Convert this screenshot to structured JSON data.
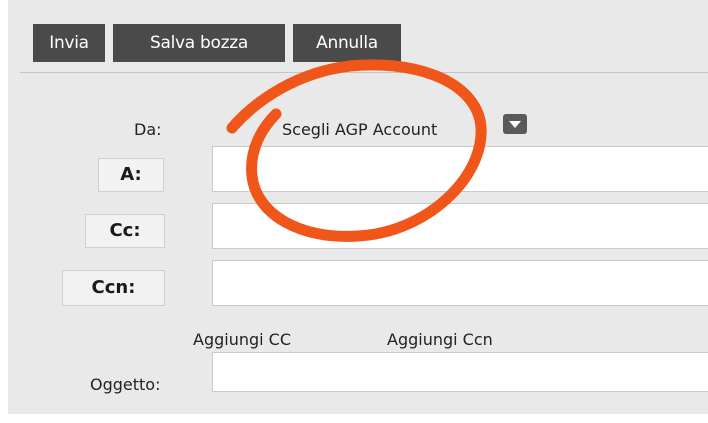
{
  "toolbar": {
    "send_label": "Invia",
    "save_draft_label": "Salva bozza",
    "cancel_label": "Annulla"
  },
  "form": {
    "from_label": "Da:",
    "from_value": "Scegli AGP Account",
    "to_label": "A:",
    "to_value": "",
    "cc_label": "Cc:",
    "cc_value": "",
    "bcc_label": "Ccn:",
    "bcc_value": "",
    "add_cc_label": "Aggiungi CC",
    "add_bcc_label": "Aggiungi Ccn",
    "subject_label": "Oggetto:",
    "subject_value": ""
  },
  "icons": {
    "dropdown": "chevron-down-icon"
  },
  "colors": {
    "toolbar_button": "#4a4a4a",
    "panel_background": "#e9e9e9",
    "annotation_stroke": "#f0561a"
  }
}
